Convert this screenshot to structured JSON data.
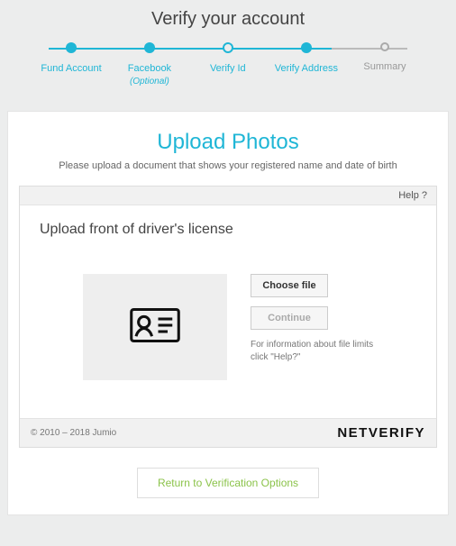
{
  "page_title": "Verify your account",
  "stepper": {
    "steps": [
      {
        "label": "Fund Account",
        "sub": ""
      },
      {
        "label": "Facebook",
        "sub": "(Optional)"
      },
      {
        "label": "Verify Id",
        "sub": ""
      },
      {
        "label": "Verify Address",
        "sub": ""
      },
      {
        "label": "Summary",
        "sub": ""
      }
    ]
  },
  "card": {
    "title": "Upload Photos",
    "subtitle": "Please upload a document that shows your registered name and date of birth"
  },
  "widget": {
    "help_label": "Help ?",
    "prompt": "Upload front of driver's license",
    "choose_label": "Choose file",
    "continue_label": "Continue",
    "hint": "For information about file limits click \"Help?\"",
    "copyright": "© 2010 – 2018 Jumio",
    "brand": "NETVERIFY"
  },
  "return_label": "Return to Verification Options"
}
